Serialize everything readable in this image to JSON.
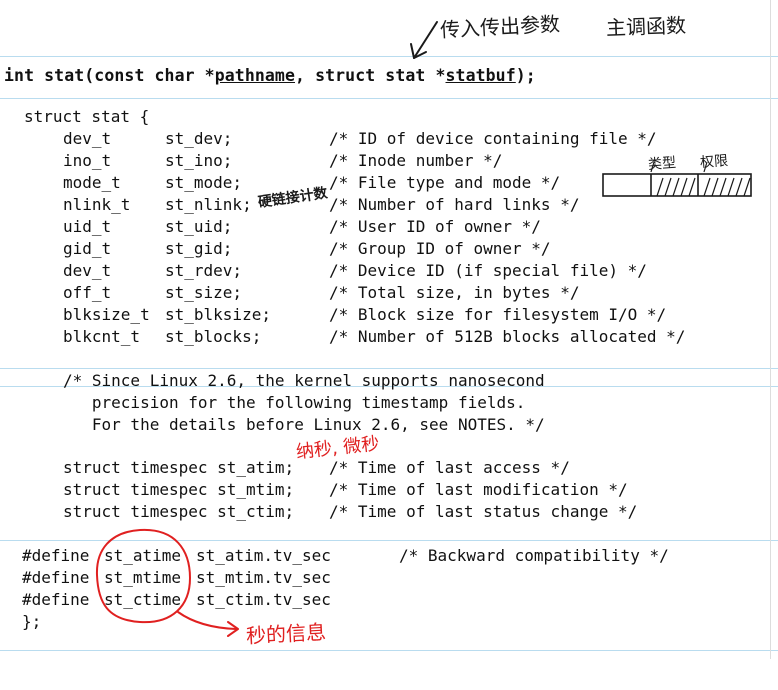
{
  "signature": {
    "prefix": "int stat(const char *",
    "param1": "pathname",
    "middle": ", struct stat *",
    "param2": "statbuf",
    "suffix": ");"
  },
  "struct_open": "struct stat {",
  "fields": [
    {
      "type": "dev_t",
      "name": "st_dev;",
      "comment": "/* ID of device containing file */"
    },
    {
      "type": "ino_t",
      "name": "st_ino;",
      "comment": "/* Inode number */"
    },
    {
      "type": "mode_t",
      "name": "st_mode;",
      "comment": "/* File type and mode */"
    },
    {
      "type": "nlink_t",
      "name": "st_nlink;",
      "comment": "/* Number of hard links */"
    },
    {
      "type": "uid_t",
      "name": "st_uid;",
      "comment": "/* User ID of owner */"
    },
    {
      "type": "gid_t",
      "name": "st_gid;",
      "comment": "/* Group ID of owner */"
    },
    {
      "type": "dev_t",
      "name": "st_rdev;",
      "comment": "/* Device ID (if special file) */"
    },
    {
      "type": "off_t",
      "name": "st_size;",
      "comment": "/* Total size, in bytes */"
    },
    {
      "type": "blksize_t",
      "name": "st_blksize;",
      "comment": "/* Block size for filesystem I/O */"
    },
    {
      "type": "blkcnt_t",
      "name": "st_blocks;",
      "comment": "/* Number of 512B blocks allocated */"
    }
  ],
  "linux_comment": [
    "/* Since Linux 2.6, the kernel supports nanosecond",
    "   precision for the following timestamp fields.",
    "   For the details before Linux 2.6, see NOTES. */"
  ],
  "timespecs": [
    {
      "decl": "struct timespec st_atim;",
      "comment": "/* Time of last access */"
    },
    {
      "decl": "struct timespec st_mtim;",
      "comment": "/* Time of last modification */"
    },
    {
      "decl": "struct timespec st_ctim;",
      "comment": "/* Time of last status change */"
    }
  ],
  "defines": [
    {
      "keyword": "#define",
      "macro": "st_atime",
      "value": "st_atim.tv_sec",
      "comment": "/* Backward compatibility */"
    },
    {
      "keyword": "#define",
      "macro": "st_mtime",
      "value": "st_mtim.tv_sec",
      "comment": ""
    },
    {
      "keyword": "#define",
      "macro": "st_ctime",
      "value": "st_ctim.tv_sec",
      "comment": ""
    }
  ],
  "struct_close": "};",
  "annotations": {
    "top_note": "传入传出参数",
    "top_note_2": "主调函数",
    "mode_type": "类型",
    "mode_perm": "权限",
    "nlink_note": "硬链接计数",
    "timespec_note": "纳秒, 微秒",
    "seconds_note": "秒的信息"
  },
  "colors": {
    "text": "#111111",
    "pen_black": "#1a1a1a",
    "pen_red": "#e02020",
    "rule_line": "#b9dcef"
  }
}
